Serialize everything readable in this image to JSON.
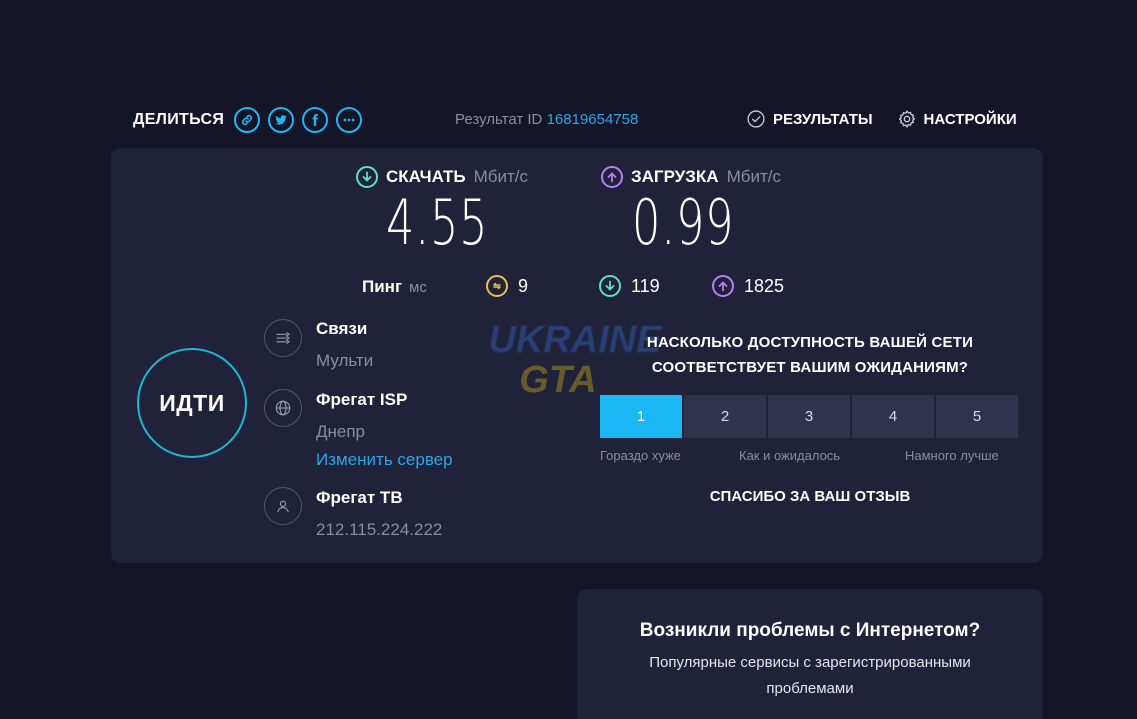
{
  "header": {
    "share_label": "ДЕЛИТЬСЯ",
    "share_buttons": [
      "link-icon",
      "twitter-icon",
      "facebook-icon",
      "more-icon"
    ],
    "result_label": "Результат ID",
    "result_id": "16819654758",
    "results_label": "РЕЗУЛЬТАТЫ",
    "settings_label": "НАСТРОЙКИ"
  },
  "download": {
    "label": "СКАЧАТЬ",
    "unit": "Мбит/с",
    "value": "4.55",
    "color": "#5fe0c8"
  },
  "upload": {
    "label": "ЗАГРУЗКА",
    "unit": "Мбит/с",
    "value": "0.99",
    "color": "#b77ef2"
  },
  "ping": {
    "label": "Пинг",
    "unit": "мс",
    "idle": "9",
    "download": "119",
    "upload": "1825",
    "idle_color": "#e8c24a"
  },
  "go_label": "ИДТИ",
  "connections": {
    "title": "Связи",
    "value": "Мульти"
  },
  "server": {
    "title": "Фрегат ISP",
    "location": "Днепр",
    "change_link": "Изменить сервер"
  },
  "provider": {
    "title": "Фрегат ТВ",
    "ip": "212.115.224.222"
  },
  "survey": {
    "question_line1": "НАСКОЛЬКО ДОСТУПНОСТЬ ВАШЕЙ СЕТИ",
    "question_line2": "СООТВЕТСТВУЕТ ВАШИМ ОЖИДАНИЯМ?",
    "options": [
      "1",
      "2",
      "3",
      "4",
      "5"
    ],
    "selected": "1",
    "label_low": "Гораздо хуже",
    "label_mid": "Как и ожидалось",
    "label_high": "Намного лучше",
    "thanks": "СПАСИБО ЗА ВАШ ОТЗЫВ"
  },
  "watermark": {
    "line1": "UKRAINE",
    "line2": "GTA"
  },
  "problems": {
    "title": "Возникли проблемы с Интернетом?",
    "subtitle_line1": "Популярные сервисы с зарегистрированными",
    "subtitle_line2": "проблемами"
  },
  "colors": {
    "accent": "#1fb6f2",
    "background": "#141526",
    "panel": "#20223a"
  }
}
